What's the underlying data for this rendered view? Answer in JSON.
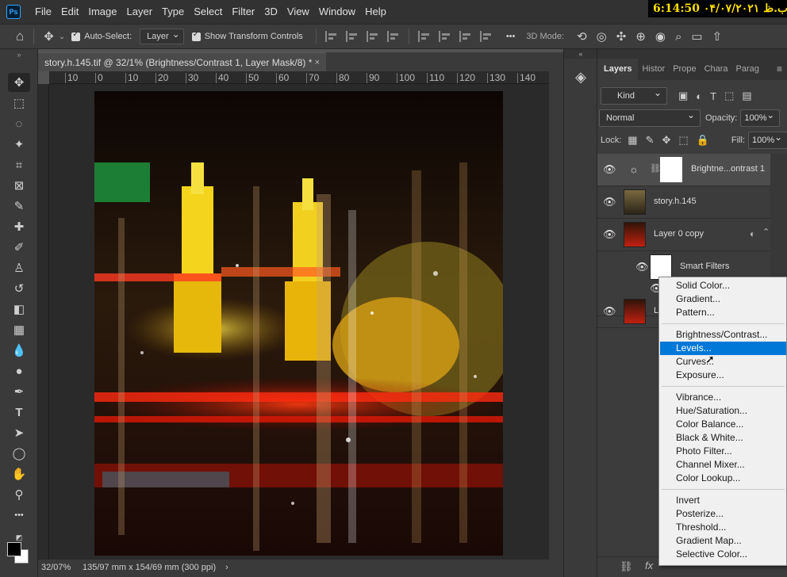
{
  "app": {
    "logo": "Ps",
    "clock": "6:14:50  ۰۴/۰۷/۲۰۲۱ ب.ظ"
  },
  "menu": [
    "File",
    "Edit",
    "Image",
    "Layer",
    "Type",
    "Select",
    "Filter",
    "3D",
    "View",
    "Window",
    "Help"
  ],
  "options": {
    "auto_select": "Auto-Select:",
    "auto_select_target": "Layer",
    "transform_controls": "Show Transform Controls",
    "more": "•••",
    "mode_3d": "3D Mode:"
  },
  "document": {
    "tab_title": "story.h.145.tif @ 32/1% (Brightness/Contrast 1, Layer Mask/8) *",
    "close": "×",
    "ruler_ticks": [
      "10",
      "0",
      "10",
      "20",
      "30",
      "40",
      "50",
      "60",
      "70",
      "80",
      "90",
      "100",
      "110",
      "120",
      "130",
      "140"
    ],
    "zoom": "32/07%",
    "doc_info": "135/97 mm x 154/69 mm (300 ppi)",
    "status_arrow": "›"
  },
  "panel": {
    "tabs": [
      "Layers",
      "Histor",
      "Prope",
      "Chara",
      "Parag"
    ],
    "menu_icon": "≡",
    "kind": "Kind",
    "blend_mode": "Normal",
    "opacity_label": "Opacity:",
    "opacity": "100%",
    "lock_label": "Lock:",
    "fill_label": "Fill:",
    "fill": "100%",
    "layers": [
      {
        "name": "Brightne...ontrast 1"
      },
      {
        "name": "story.h.145"
      },
      {
        "name": "Layer 0 copy"
      },
      {
        "name": "Smart Filters"
      },
      {
        "name": "L"
      }
    ]
  },
  "context_menu": {
    "group1": [
      "Solid Color...",
      "Gradient...",
      "Pattern..."
    ],
    "group2": [
      "Brightness/Contrast...",
      "Levels...",
      "Curves...",
      "Exposure..."
    ],
    "group3": [
      "Vibrance...",
      "Hue/Saturation...",
      "Color Balance...",
      "Black & White...",
      "Photo Filter...",
      "Channel Mixer...",
      "Color Lookup..."
    ],
    "group4": [
      "Invert",
      "Posterize...",
      "Threshold...",
      "Gradient Map...",
      "Selective Color..."
    ],
    "highlighted": "Levels..."
  }
}
